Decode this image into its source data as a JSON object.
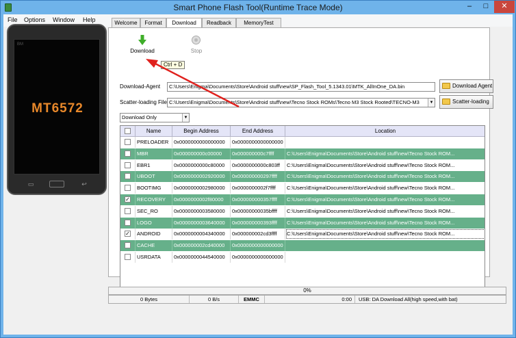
{
  "window": {
    "title": "Smart Phone Flash Tool(Runtime Trace Mode)",
    "min_glyph": "–",
    "max_glyph": "□",
    "close_glyph": "✕"
  },
  "menu": [
    "File",
    "Options",
    "Window",
    "Help"
  ],
  "phone": {
    "brand": "BM",
    "model": "MT6572"
  },
  "tabs": [
    "Welcome",
    "Format",
    "Download",
    "Readback",
    "MemoryTest"
  ],
  "active_tab": "Download",
  "toolbar": {
    "download_label": "Download",
    "stop_label": "Stop",
    "tooltip": "Ctrl + D"
  },
  "download_agent": {
    "label": "Download-Agent",
    "value": "C:\\Users\\Enigma\\Documents\\Store\\Android stuff\\new\\SP_Flash_Tool_5.1343.01\\MTK_AllInOne_DA.bin",
    "button": "Download Agent"
  },
  "scatter": {
    "label": "Scatter-loading File",
    "value": "C:\\Users\\Enigma\\Documents\\Store\\Android stuff\\new\\Tecno Stock ROMs\\Tecno M3 Stock Rooted\\TECNO-M3",
    "button": "Scatter-loading"
  },
  "mode": {
    "selected": "Download Only"
  },
  "table": {
    "headers": [
      "Name",
      "Begin Address",
      "End Address",
      "Location"
    ],
    "rows": [
      {
        "checked": false,
        "hl": false,
        "name": "PRELOADER",
        "begin": "0x0000000000000000",
        "end": "0x0000000000000000",
        "loc": ""
      },
      {
        "checked": false,
        "hl": true,
        "name": "MBR",
        "begin": "0x000000000c00000",
        "end": "0x000000000c7ffff",
        "loc": "C:\\Users\\Enigma\\Documents\\Store\\Android stuff\\new\\Tecno Stock ROM..."
      },
      {
        "checked": false,
        "hl": false,
        "name": "EBR1",
        "begin": "0x0000000000c80000",
        "end": "0x0000000000c803ff",
        "loc": "C:\\Users\\Enigma\\Documents\\Store\\Android stuff\\new\\Tecno Stock ROM..."
      },
      {
        "checked": false,
        "hl": true,
        "name": "UBOOT",
        "begin": "0x0000000002920000",
        "end": "0x000000000297ffff",
        "loc": "C:\\Users\\Enigma\\Documents\\Store\\Android stuff\\new\\Tecno Stock ROM..."
      },
      {
        "checked": false,
        "hl": false,
        "name": "BOOTIMG",
        "begin": "0x0000000002980000",
        "end": "0x0000000002f7ffff",
        "loc": "C:\\Users\\Enigma\\Documents\\Store\\Android stuff\\new\\Tecno Stock ROM..."
      },
      {
        "checked": true,
        "hl": true,
        "name": "RECOVERY",
        "begin": "0x0000000002f80000",
        "end": "0x000000000357ffff",
        "loc": "C:\\Users\\Enigma\\Documents\\Store\\Android stuff\\new\\Tecno Stock ROM..."
      },
      {
        "checked": false,
        "hl": false,
        "name": "SEC_RO",
        "begin": "0x0000000003580000",
        "end": "0x00000000035bffff",
        "loc": "C:\\Users\\Enigma\\Documents\\Store\\Android stuff\\new\\Tecno Stock ROM..."
      },
      {
        "checked": false,
        "hl": true,
        "name": "LOGO",
        "begin": "0x0000000003640000",
        "end": "0x000000000393ffff",
        "loc": "C:\\Users\\Enigma\\Documents\\Store\\Android stuff\\new\\Tecno Stock ROM..."
      },
      {
        "checked": true,
        "hl": false,
        "dashed": true,
        "name": "ANDROID",
        "begin": "0x0000000004340000",
        "end": "0x000000002cd3ffff",
        "loc": "C:\\Users\\Enigma\\Documents\\Store\\Android stuff\\new\\Tecno Stock ROM..."
      },
      {
        "checked": false,
        "hl": true,
        "name": "CACHE",
        "begin": "0x000000002cd40000",
        "end": "0x0000000000000000",
        "loc": ""
      },
      {
        "checked": false,
        "hl": false,
        "name": "USRDATA",
        "begin": "0x0000000044540000",
        "end": "0x0000000000000000",
        "loc": ""
      }
    ]
  },
  "progress": {
    "text": "0%",
    "value": 0
  },
  "status": {
    "bytes": "0 Bytes",
    "speed": "0 B/s",
    "storage": "EMMC",
    "time": "0:00",
    "usb": "USB: DA Download All(high speed,with bat)"
  },
  "colors": {
    "highlight_row": "#66b08a",
    "header_row": "#e4e5f7",
    "arrow": "#e0211d",
    "close_button": "#c9463d"
  }
}
